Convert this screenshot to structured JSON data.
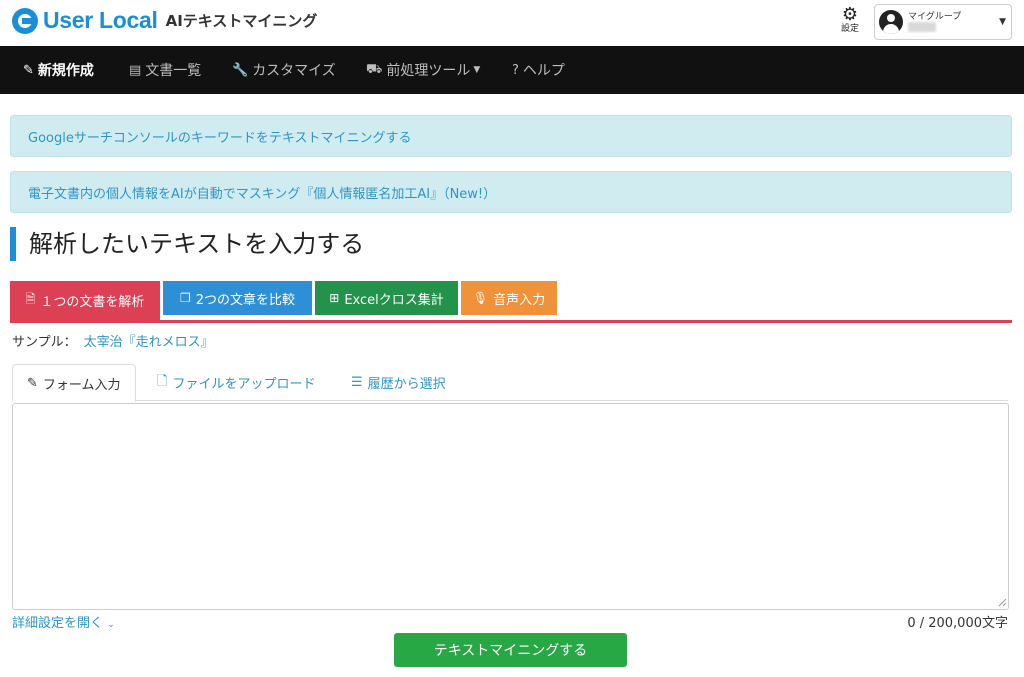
{
  "header": {
    "brand": "User Local",
    "product": "AIテキストマイニング",
    "settings_label": "設定",
    "user_group": "マイグループ"
  },
  "nav": {
    "items": [
      {
        "label": "新規作成",
        "icon": "pencil-icon",
        "active": true
      },
      {
        "label": "文書一覧",
        "icon": "document-icon"
      },
      {
        "label": "カスタマイズ",
        "icon": "wrench-icon"
      },
      {
        "label": "前処理ツール",
        "icon": "toolbox-icon"
      },
      {
        "label": "ヘルプ",
        "icon": "help-circle-icon"
      }
    ]
  },
  "alerts": [
    "Googleサーチコンソールのキーワードをテキストマイニングする",
    "電子文書内の個人情報をAIが自動でマスキング『個人情報匿名加工AI』（New!）"
  ],
  "page_title": "解析したいテキストを入力する",
  "mode_tabs": [
    {
      "label": "１つの文書を解析",
      "icon": "file-icon",
      "color": "#dc4055"
    },
    {
      "label": "2つの文章を比較",
      "icon": "copy-icon",
      "color": "#2d8fd5"
    },
    {
      "label": "Excelクロス集計",
      "icon": "table-icon",
      "color": "#23924a"
    },
    {
      "label": "音声入力",
      "icon": "microphone-icon",
      "color": "#f0923a"
    }
  ],
  "sample": {
    "label": "サンプル：",
    "link": "太宰治『走れメロス』"
  },
  "input_tabs": [
    {
      "label": "フォーム入力",
      "icon": "edit-icon",
      "active": true
    },
    {
      "label": "ファイルをアップロード",
      "icon": "file-outline-icon"
    },
    {
      "label": "履歴から選択",
      "icon": "list-icon"
    }
  ],
  "textarea": {
    "value": ""
  },
  "advanced_label": "詳細設定を開く",
  "counter": "0 / 200,000文字",
  "submit_label": "テキストマイニングする"
}
